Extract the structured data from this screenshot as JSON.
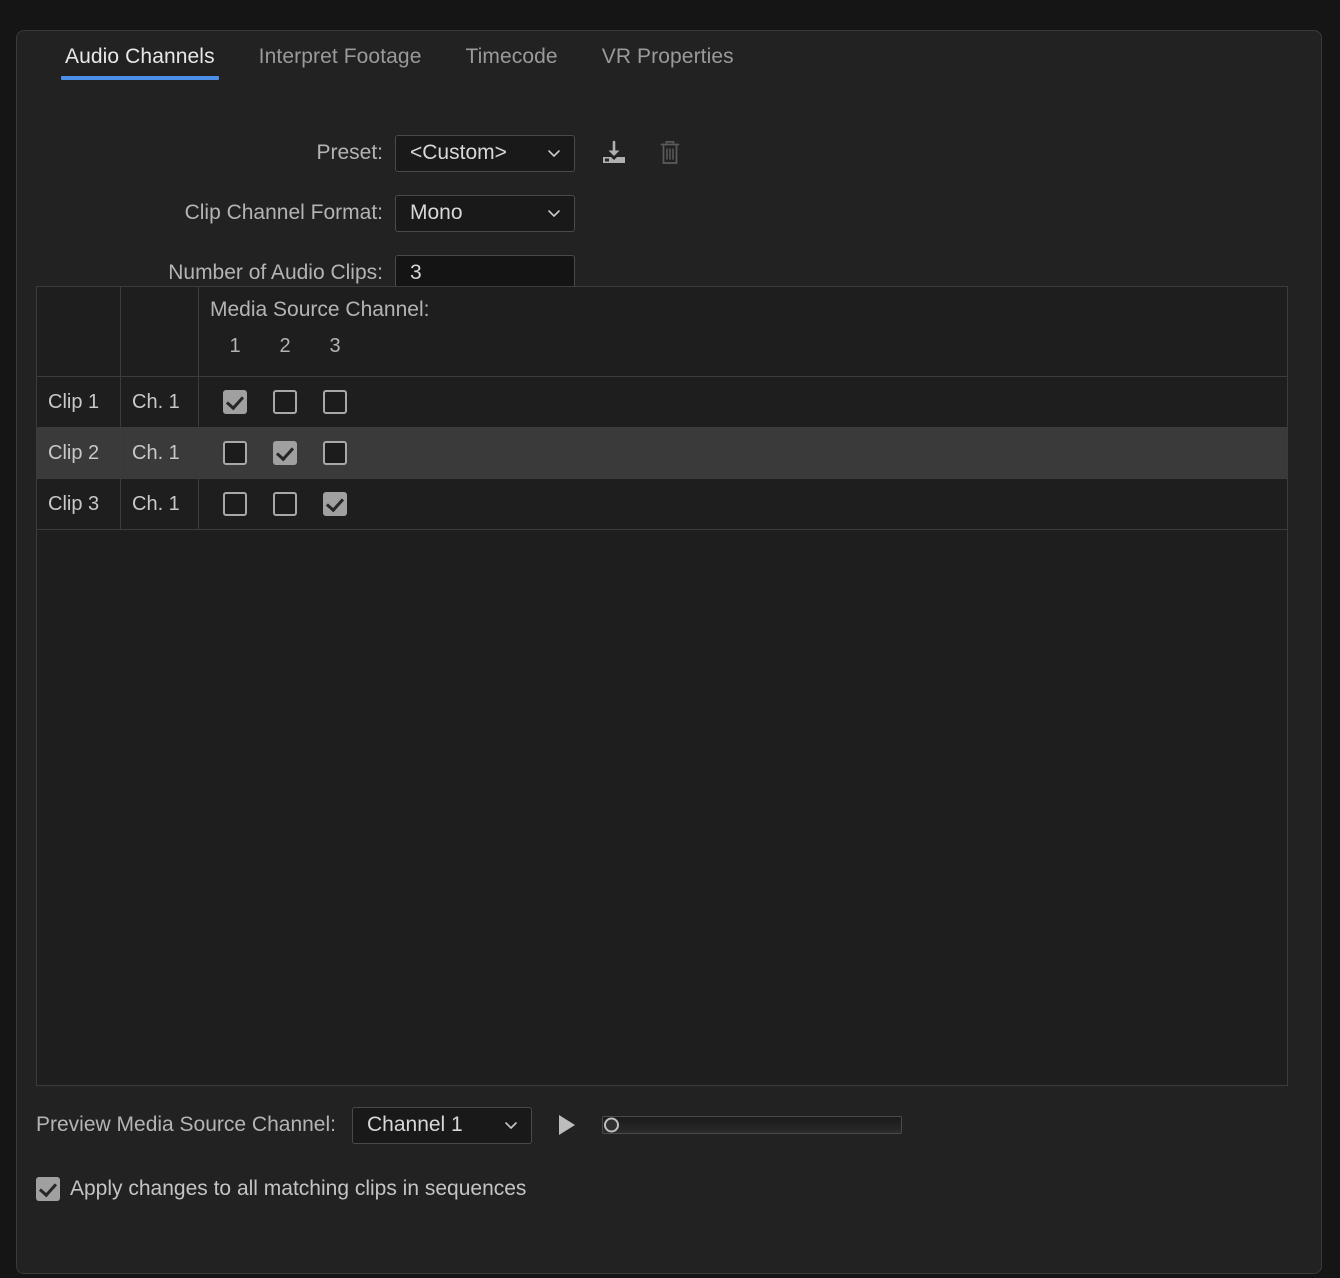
{
  "tabs": [
    {
      "label": "Audio Channels",
      "active": true
    },
    {
      "label": "Interpret Footage",
      "active": false
    },
    {
      "label": "Timecode",
      "active": false
    },
    {
      "label": "VR Properties",
      "active": false
    }
  ],
  "form": {
    "preset": {
      "label": "Preset:",
      "value": "<Custom>",
      "save_icon": "save-preset-icon",
      "delete_icon": "trash-icon"
    },
    "clip_channel_format": {
      "label": "Clip Channel Format:",
      "value": "Mono"
    },
    "number_of_audio_clips": {
      "label": "Number of Audio Clips:",
      "value": "3"
    }
  },
  "table": {
    "header_title": "Media Source Channel:",
    "column_numbers": [
      "1",
      "2",
      "3"
    ],
    "rows": [
      {
        "clip": "Clip 1",
        "channel": "Ch. 1",
        "checks": [
          true,
          false,
          false
        ],
        "highlighted": false
      },
      {
        "clip": "Clip 2",
        "channel": "Ch. 1",
        "checks": [
          false,
          true,
          false
        ],
        "highlighted": true
      },
      {
        "clip": "Clip 3",
        "channel": "Ch. 1",
        "checks": [
          false,
          false,
          true
        ],
        "highlighted": false
      }
    ]
  },
  "bottom": {
    "preview_label": "Preview Media Source Channel:",
    "preview_channel_value": "Channel 1",
    "play_icon": "play-icon",
    "slider_position_percent": 0,
    "apply_checkbox_checked": true,
    "apply_label": "Apply changes to all matching clips in sequences"
  },
  "colors": {
    "accent": "#4b8fe8",
    "panel_bg": "#222222",
    "window_bg": "#151515",
    "table_bg": "#1e1e1e",
    "row_highlight": "#3a3a3a",
    "text_primary": "#e8e8e8",
    "text_secondary": "#b4b4b4"
  }
}
